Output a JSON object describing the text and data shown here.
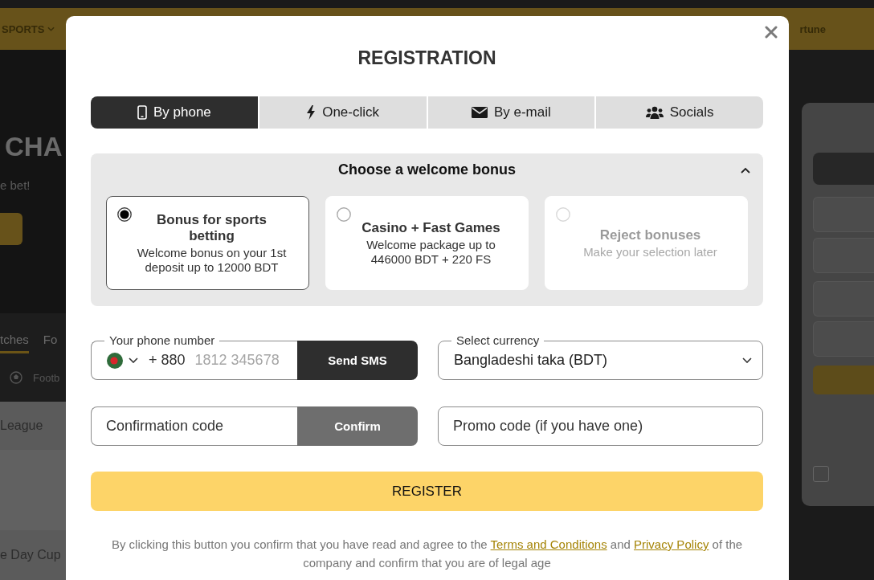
{
  "background": {
    "top_bar": {
      "left_item": "SPORTS",
      "right_item": "rtune"
    },
    "hero": {
      "title": "CHA",
      "subtitle": "e bet!"
    },
    "match_tabs": [
      {
        "label": "tches",
        "selected": true
      },
      {
        "label": "Fo",
        "selected": false
      }
    ],
    "sport_filter": "Footb",
    "rows": [
      "League",
      "e Day Cup"
    ]
  },
  "dialog": {
    "title": "REGISTRATION"
  },
  "tabs": [
    {
      "kind": "phone",
      "label": "By phone",
      "selected": true
    },
    {
      "kind": "one-click",
      "label": "One-click",
      "selected": false
    },
    {
      "kind": "email",
      "label": "By e-mail",
      "selected": false
    },
    {
      "kind": "socials",
      "label": "Socials",
      "selected": false
    }
  ],
  "bonus": {
    "title": "Choose a welcome bonus",
    "expanded": true,
    "options": [
      {
        "title": "Bonus for sports betting",
        "description": "Welcome bonus on your 1st deposit up to 12000 BDT",
        "selected": true,
        "disabled": false
      },
      {
        "title": "Casino + Fast Games",
        "description": "Welcome package up to 446000 BDT + 220 FS",
        "selected": false,
        "disabled": false
      },
      {
        "title": "Reject bonuses",
        "description": "Make your selection later",
        "selected": false,
        "disabled": true
      }
    ]
  },
  "phone": {
    "label": "Your phone number",
    "country_code": "+ 880",
    "placeholder": "1812 345678",
    "button": "Send SMS"
  },
  "currency": {
    "label": "Select currency",
    "value": "Bangladeshi taka (BDT)"
  },
  "confirmation": {
    "placeholder": "Confirmation code",
    "button": {
      "label": "Confirm",
      "disabled": true
    }
  },
  "promo": {
    "placeholder": "Promo code (if you have one)"
  },
  "register_button": "REGISTER",
  "legal": [
    {
      "kind": "text",
      "text": "By clicking this button you confirm that you have read and agree to the "
    },
    {
      "kind": "link",
      "text": "Terms and Conditions"
    },
    {
      "kind": "text",
      "text": " and "
    },
    {
      "kind": "link",
      "text": "Privacy Policy"
    },
    {
      "kind": "text",
      "text": " of the company and confirm that you are of legal age"
    }
  ]
}
